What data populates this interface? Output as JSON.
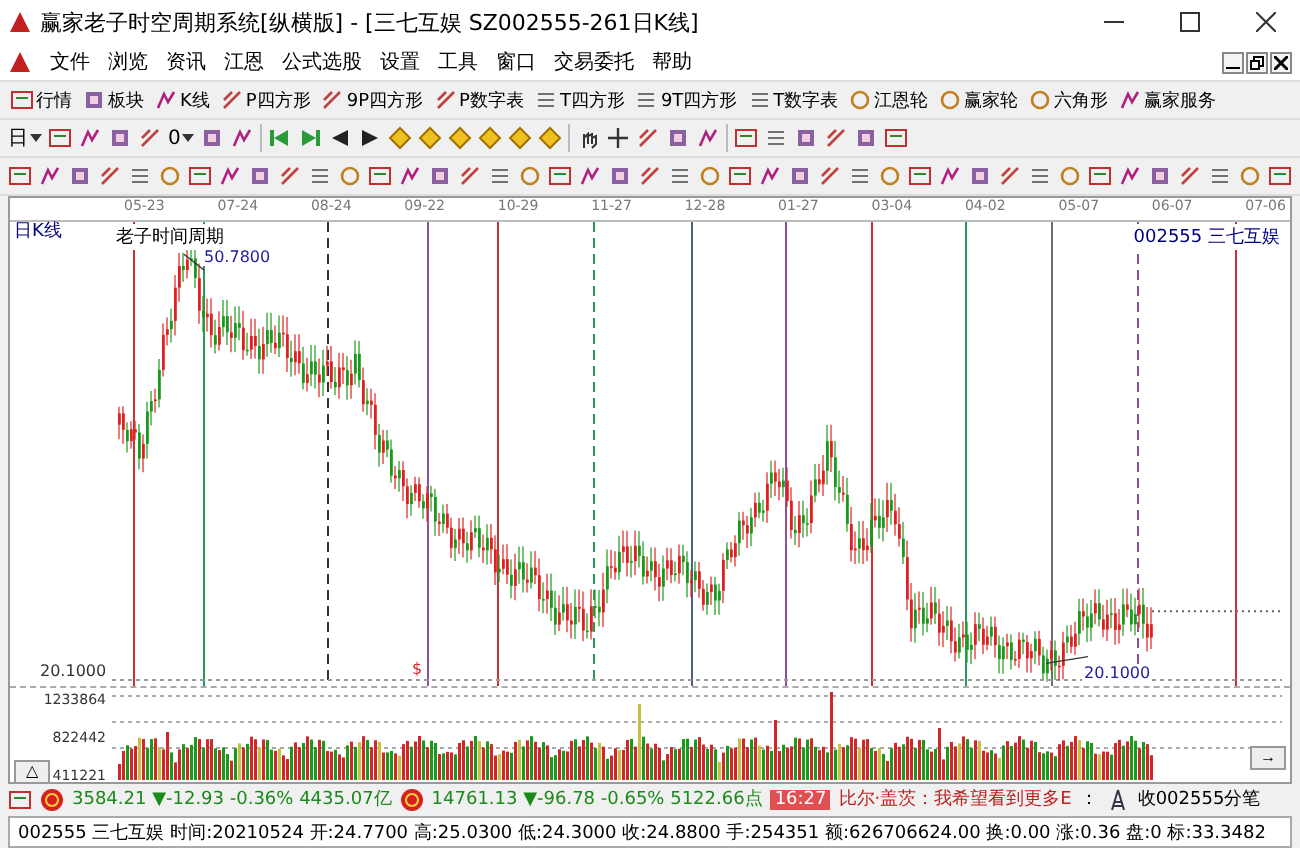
{
  "window": {
    "title": "赢家老子时空周期系统[纵横版] - [三七互娱  SZ002555-261日K线]"
  },
  "menu": [
    "文件",
    "浏览",
    "资讯",
    "江恩",
    "公式选股",
    "设置",
    "工具",
    "窗口",
    "交易委托",
    "帮助"
  ],
  "toolbar": [
    "行情",
    "板块",
    "K线",
    "P四方形",
    "9P四方形",
    "P数字表",
    "T四方形",
    "9T四方形",
    "T数字表",
    "江恩轮",
    "赢家轮",
    "六角形",
    "赢家服务"
  ],
  "period_selector": {
    "value": "日"
  },
  "offset_selector": {
    "value": "0"
  },
  "chart": {
    "label": "日K线",
    "dates": [
      "05-23",
      "07-24",
      "08-24",
      "09-22",
      "10-29",
      "11-27",
      "12-28",
      "01-27",
      "03-04",
      "04-02",
      "05-07",
      "06-07",
      "07-06"
    ],
    "indicator_name": "老子时间周期",
    "high_label": "50.7800",
    "low_label": "20.1000",
    "axis_low": "20.1000",
    "code": "002555",
    "name": "三七互娱",
    "marker": "$",
    "volume_ticks": [
      "1233864",
      "822442",
      "411221"
    ],
    "collapse_button": "△",
    "scroll_button": "→"
  },
  "index_bar": {
    "sh": "3584.21 ▼-12.93 -0.36% 4435.07亿",
    "sz": "14761.13 ▼-96.78 -0.65% 5122.66点",
    "time": "16:27",
    "news": "比尔·盖茨：我希望看到更多E",
    "sep": "：",
    "trade": "收002555分笔"
  },
  "status_bar": "002555 三七互娱 时间:20210524 开:24.7700 高:25.0300 低:24.3000 收:24.8800 手:254351 额:626706624.00 换:0.00 涨:0.36 盘:0 标:33.3482"
}
